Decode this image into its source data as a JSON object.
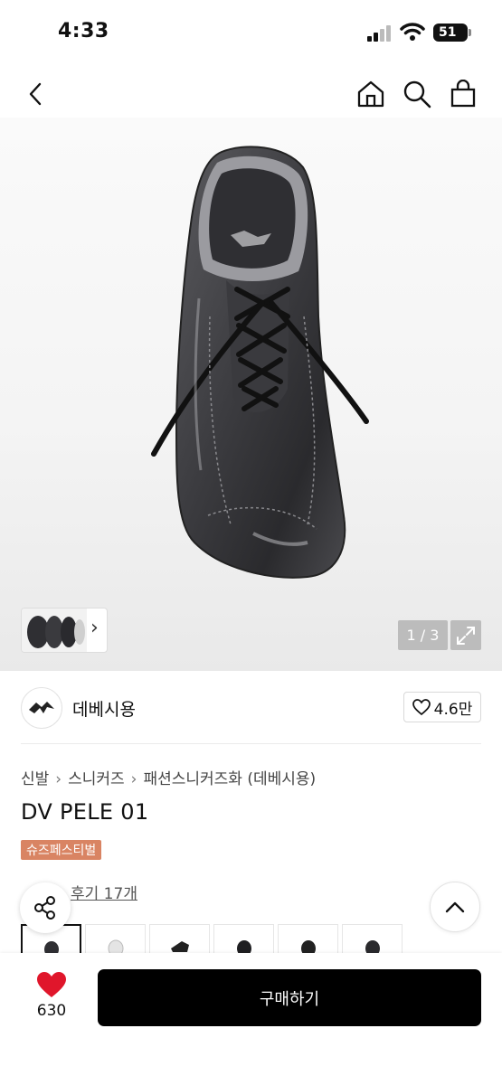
{
  "status_bar": {
    "time": "4:33",
    "battery": "51"
  },
  "nav": {
    "back_icon": "chevron-left-icon",
    "home_icon": "home-icon",
    "search_icon": "search-icon",
    "cart_icon": "shopping-bag-icon"
  },
  "gallery": {
    "counter": "1 / 3",
    "thumb_arrow": "›"
  },
  "brand": {
    "name": "데베시용",
    "likes": "4.6만"
  },
  "breadcrumb": [
    "신발",
    "스니커즈",
    "패션스니커즈화 (데베시용)"
  ],
  "product": {
    "title": "DV PELE 01",
    "tag": "슈즈페스티벌",
    "review_link": "후기 17개"
  },
  "bottom": {
    "like_count": "630",
    "buy_label": "구매하기"
  },
  "colors": {
    "tag_bg": "#d98463",
    "buy_bg": "#000000",
    "heart": "#e0162b"
  }
}
